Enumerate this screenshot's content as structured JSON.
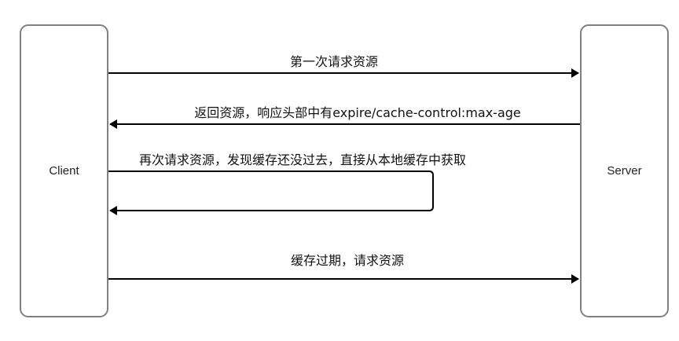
{
  "diagram": {
    "client": {
      "label": "Client"
    },
    "server": {
      "label": "Server"
    },
    "messages": [
      {
        "label": "第一次请求资源"
      },
      {
        "label": "返回资源，响应头部中有expire/cache-control:max-age"
      },
      {
        "label": "再次请求资源，发现缓存还没过去，直接从本地缓存中获取"
      },
      {
        "label": "缓存过期，请求资源"
      }
    ]
  },
  "colors": {
    "box_stroke": "#808080",
    "line": "#000000",
    "text": "#111111"
  }
}
